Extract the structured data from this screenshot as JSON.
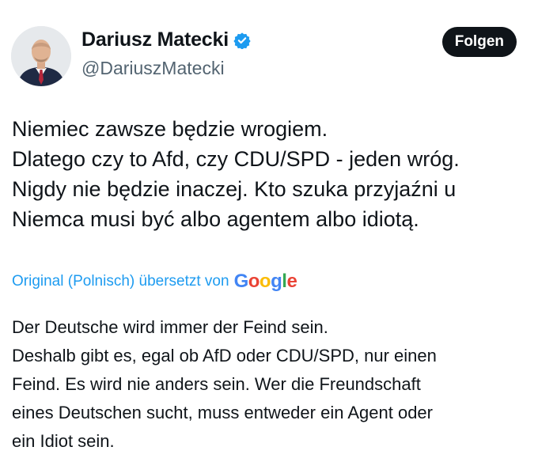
{
  "author": {
    "display_name": "Dariusz Matecki",
    "handle": "@DariuszMatecki",
    "verified": true,
    "avatar_icon": "profile-photo"
  },
  "follow_button": {
    "label": "Folgen"
  },
  "tweet": {
    "lines": [
      "Niemiec zawsze będzie wrogiem.",
      "Dlatego czy to Afd, czy CDU/SPD - jeden wróg.",
      "Nigdy nie będzie inaczej. Kto szuka przyjaźni u",
      "Niemca musi być albo agentem albo idiotą."
    ]
  },
  "translation_credit": {
    "label": "Original (Polnisch) übersetzt von",
    "provider": "Google"
  },
  "translation": {
    "lines": [
      "Der Deutsche wird immer der Feind sein.",
      "Deshalb gibt es, egal ob AfD oder CDU/SPD, nur einen",
      "Feind. Es wird nie anders sein. Wer die Freundschaft",
      "eines Deutschen sucht, muss entweder ein Agent oder",
      "ein Idiot sein."
    ]
  },
  "colors": {
    "link": "#1d9bf0",
    "verified": "#1d9bf0",
    "button_bg": "#0f1419",
    "secondary_text": "#536471",
    "google_blue": "#4285F4",
    "google_red": "#EA4335",
    "google_yellow": "#FBBC05",
    "google_green": "#34A853"
  }
}
